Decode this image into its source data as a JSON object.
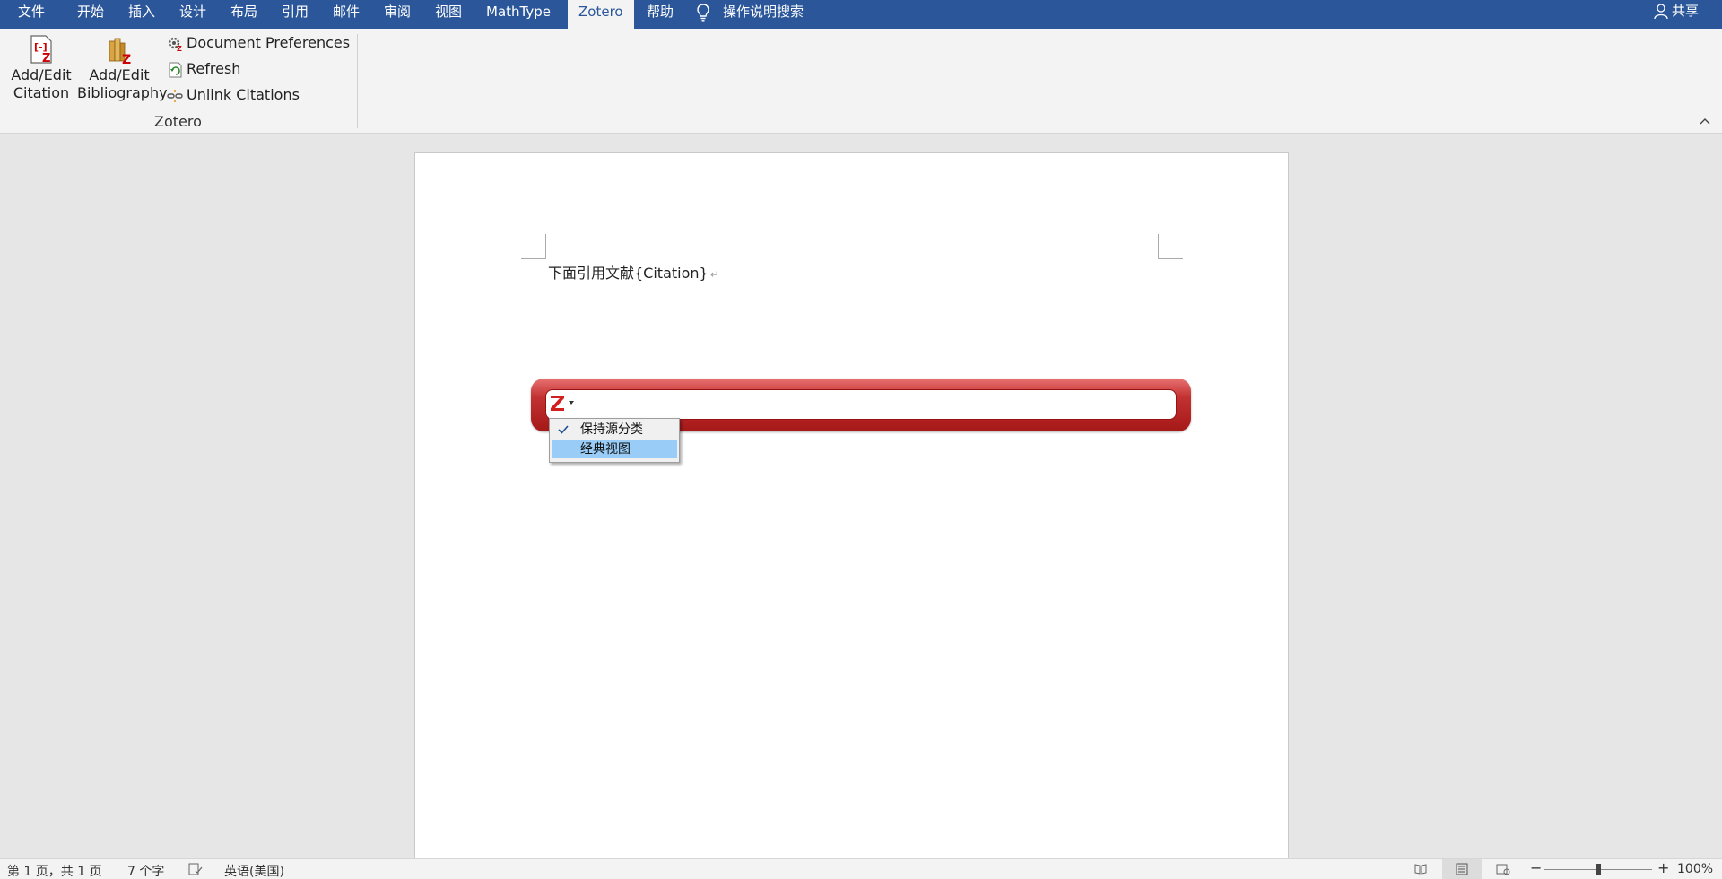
{
  "tabs": [
    {
      "label": "文件",
      "active": false
    },
    {
      "label": "开始",
      "active": false
    },
    {
      "label": "插入",
      "active": false
    },
    {
      "label": "设计",
      "active": false
    },
    {
      "label": "布局",
      "active": false
    },
    {
      "label": "引用",
      "active": false
    },
    {
      "label": "邮件",
      "active": false
    },
    {
      "label": "审阅",
      "active": false
    },
    {
      "label": "视图",
      "active": false
    },
    {
      "label": "MathType",
      "active": false
    },
    {
      "label": "Zotero",
      "active": true
    },
    {
      "label": "帮助",
      "active": false
    }
  ],
  "tell_me": {
    "label": "操作说明搜索",
    "icon": "lightbulb-icon"
  },
  "share": {
    "label": "共享",
    "icon": "person-icon"
  },
  "ribbon": {
    "add_edit_citation": {
      "line1": "Add/Edit",
      "line2": "Citation",
      "icon": "citation-icon"
    },
    "add_edit_bibliography": {
      "line1": "Add/Edit",
      "line2": "Bibliography",
      "icon": "bibliography-icon"
    },
    "document_preferences": {
      "label": "Document Preferences",
      "icon": "gear-icon"
    },
    "refresh": {
      "label": "Refresh",
      "icon": "refresh-icon"
    },
    "unlink_citations": {
      "label": "Unlink Citations",
      "icon": "unlink-icon"
    },
    "group_label": "Zotero",
    "collapse_icon": "chevron-up-icon"
  },
  "document": {
    "text": "下面引用文献{Citation}",
    "paragraph_mark": "↵"
  },
  "zotero_bar": {
    "logo": "zotero-logo-icon",
    "input_value": "",
    "accent": "#b22222"
  },
  "zotero_menu": {
    "items": [
      {
        "label": "保持源分类",
        "checked": true
      },
      {
        "label": "经典视图",
        "checked": false,
        "highlighted": true
      }
    ]
  },
  "statusbar": {
    "page": "第 1 页，共 1 页",
    "words": "7 个字",
    "language": "英语(美国)",
    "zoom": "100%"
  },
  "colors": {
    "word_blue": "#2b579a",
    "ribbon_bg": "#f3f3f3",
    "menu_highlight": "#99cdf8"
  }
}
